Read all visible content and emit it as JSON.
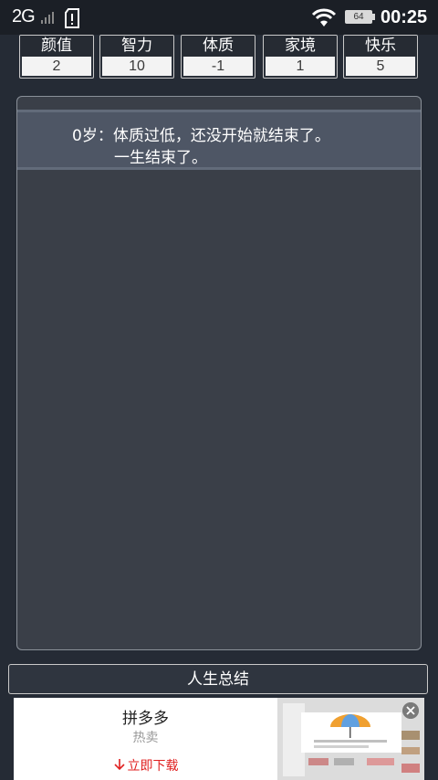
{
  "status_bar": {
    "network": "2G",
    "battery": "64",
    "time": "00:25"
  },
  "stats": [
    {
      "label": "颜值",
      "value": "2"
    },
    {
      "label": "智力",
      "value": "10"
    },
    {
      "label": "体质",
      "value": "-1"
    },
    {
      "label": "家境",
      "value": "1"
    },
    {
      "label": "快乐",
      "value": "5"
    }
  ],
  "log": {
    "entries": [
      {
        "line1": "0岁：体质过低，还没开始就结束了。",
        "line2": "一生结束了。"
      }
    ]
  },
  "summary_button": {
    "label": "人生总结"
  },
  "ad": {
    "title": "拼多多",
    "subtitle": "热卖",
    "cta": "立即下载",
    "cta_icon": "download-arrow-icon",
    "close_icon": "close-icon"
  },
  "colors": {
    "background": "#252b35",
    "panel": "#3a3f48",
    "highlight_row": "#4e5665",
    "cta_red": "#e02020"
  }
}
